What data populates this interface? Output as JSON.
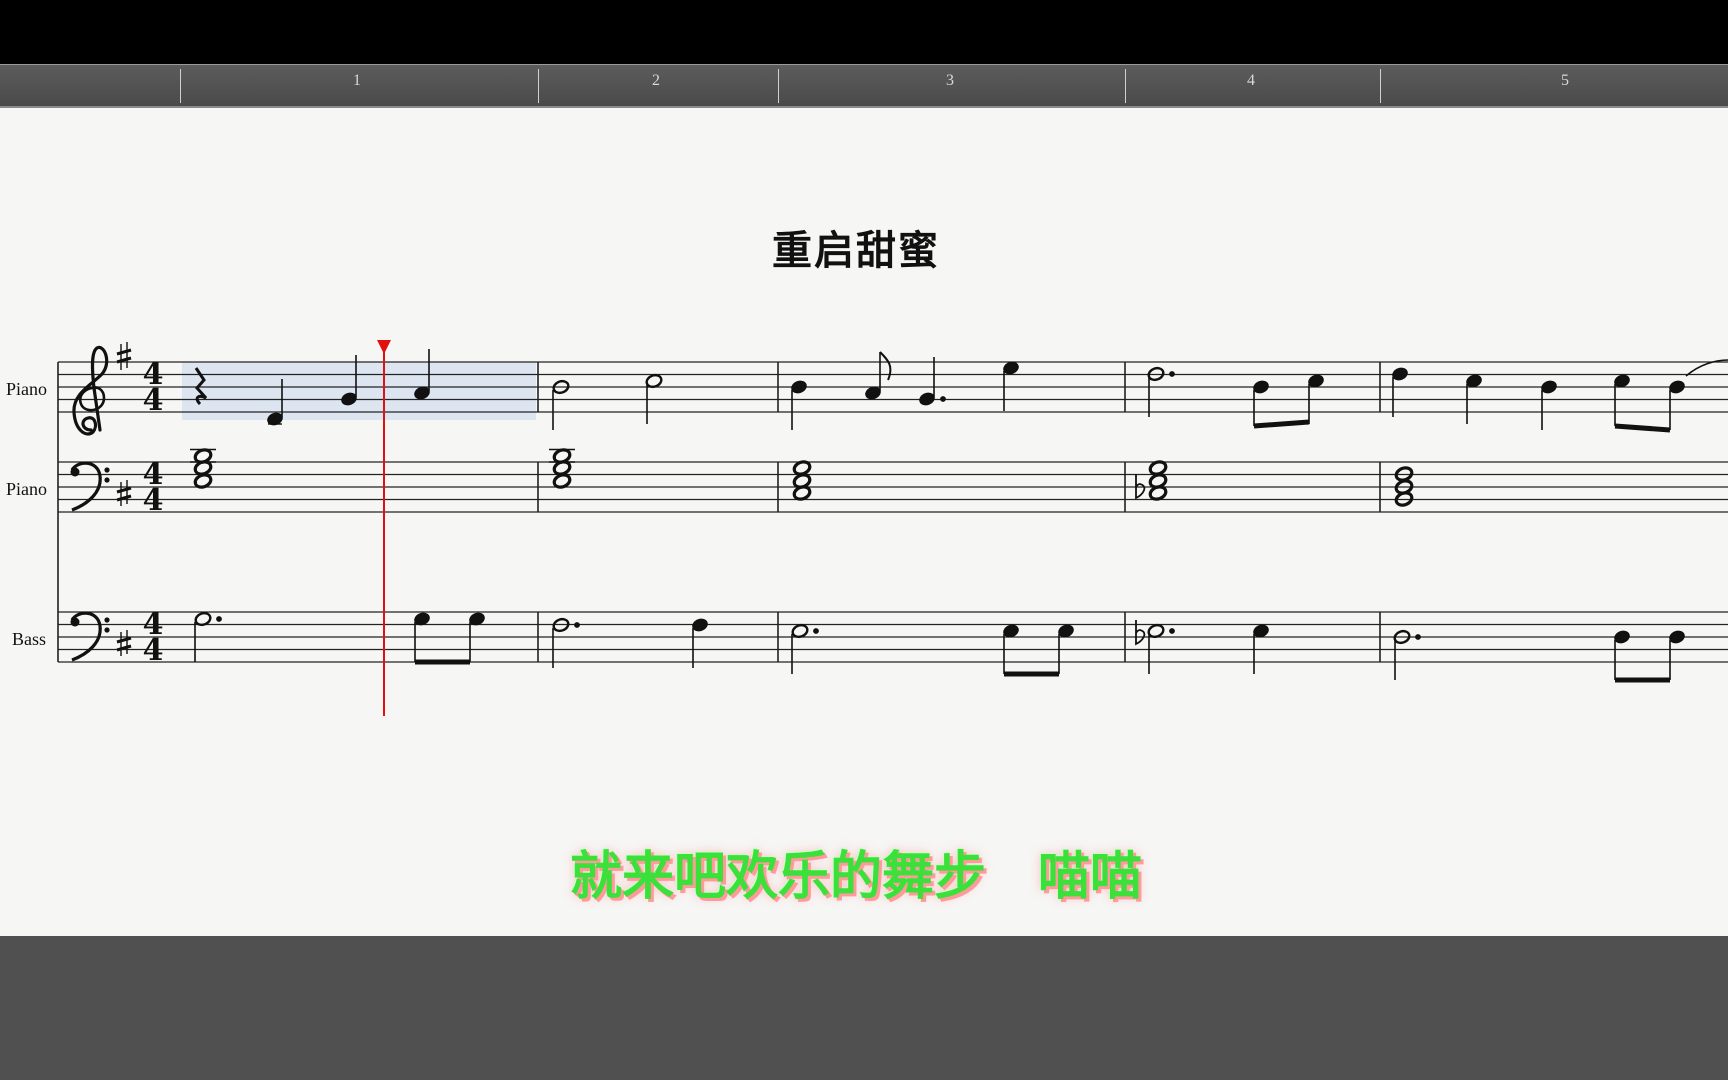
{
  "timeline": {
    "bar_numbers": [
      "1",
      "2",
      "3",
      "4",
      "5"
    ]
  },
  "score": {
    "title": "重启甜蜜",
    "staves": [
      {
        "label": "Piano",
        "clef": "treble",
        "key": "1 sharp",
        "time": "4/4"
      },
      {
        "label": "Piano",
        "clef": "bass",
        "key": "1 sharp",
        "time": "4/4"
      },
      {
        "label": "Bass",
        "clef": "bass",
        "key": "1 sharp",
        "time": "4/4"
      }
    ],
    "time_signature": {
      "num": "4",
      "den": "4"
    },
    "playback_cursor_measure": "1"
  },
  "lyric": "就来吧欢乐的舞步　喵喵",
  "colors": {
    "paper": "#f6f6f4",
    "lyric": "#3be03b",
    "lyric_shadow": "#ff9a9a",
    "cursor": "#e01010",
    "selection": "#dde6f0"
  },
  "icons": {
    "cursor_marker": "playhead-triangle-icon"
  }
}
